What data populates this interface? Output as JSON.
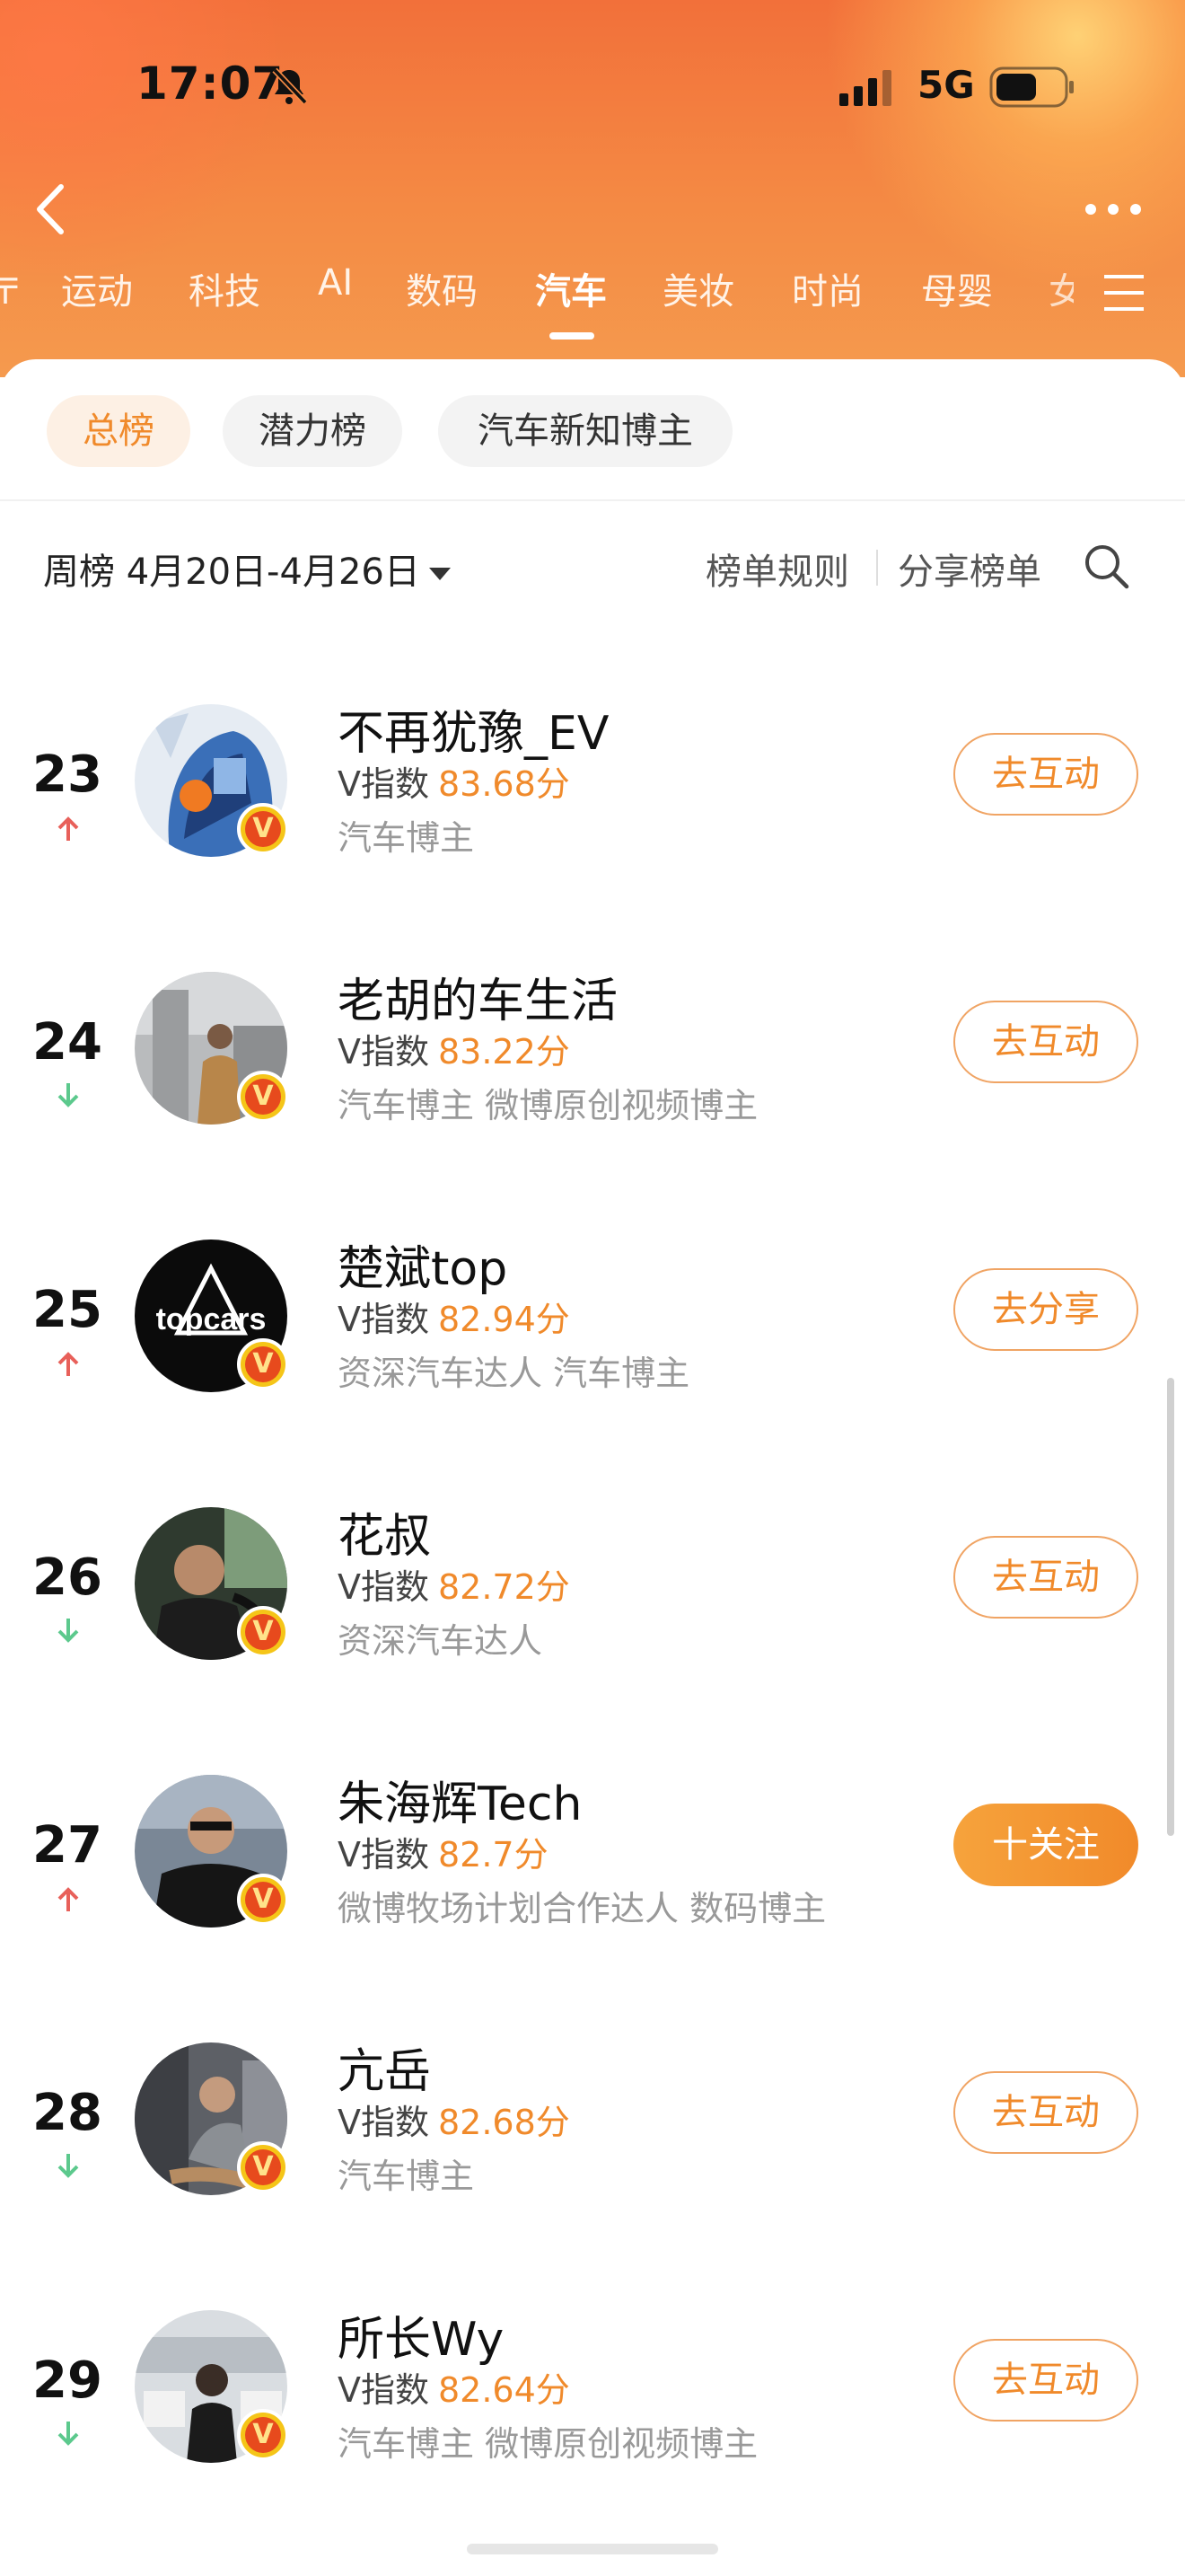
{
  "status_bar": {
    "time": "17:07",
    "network": "5G"
  },
  "header": {
    "categories": [
      "运动",
      "科技",
      "AI",
      "数码",
      "汽车",
      "美妆",
      "时尚",
      "母婴"
    ],
    "active_category": "汽车"
  },
  "segments": [
    "总榜",
    "潜力榜",
    "汽车新知博主"
  ],
  "active_segment": "总榜",
  "toolbar": {
    "week_label": "周榜 4月20日-4月26日",
    "rules_label": "榜单规则",
    "share_label": "分享榜单"
  },
  "colors": {
    "accent": "#f08a2b",
    "rise": "#e8605a",
    "fall": "#5cc98d"
  },
  "icons": {
    "back": "chevron-left-icon",
    "more": "more-dots-icon",
    "menu": "menu-icon",
    "search": "search-icon",
    "verified": "verified-v-icon"
  },
  "ranking": [
    {
      "rank": "23",
      "trend": "up",
      "name": "不再犹豫_EV",
      "vindex_label": "V指数",
      "score": "83.68分",
      "tags": "汽车博主",
      "action": "去互动",
      "action_type": "outline"
    },
    {
      "rank": "24",
      "trend": "down",
      "name": "老胡的车生活",
      "vindex_label": "V指数",
      "score": "83.22分",
      "tags": "汽车博主 微博原创视频博主",
      "action": "去互动",
      "action_type": "outline"
    },
    {
      "rank": "25",
      "trend": "up",
      "name": "楚斌top",
      "vindex_label": "V指数",
      "score": "82.94分",
      "tags": "资深汽车达人 汽车博主",
      "action": "去分享",
      "action_type": "outline"
    },
    {
      "rank": "26",
      "trend": "down",
      "name": "花叔",
      "vindex_label": "V指数",
      "score": "82.72分",
      "tags": "资深汽车达人",
      "action": "去互动",
      "action_type": "outline"
    },
    {
      "rank": "27",
      "trend": "up",
      "name": "朱海辉Tech",
      "vindex_label": "V指数",
      "score": "82.7分",
      "tags": "微博牧场计划合作达人 数码博主",
      "action": "十关注",
      "action_type": "filled"
    },
    {
      "rank": "28",
      "trend": "down",
      "name": "亢岳",
      "vindex_label": "V指数",
      "score": "82.68分",
      "tags": "汽车博主",
      "action": "去互动",
      "action_type": "outline"
    },
    {
      "rank": "29",
      "trend": "down",
      "name": "所长Wy",
      "vindex_label": "V指数",
      "score": "82.64分",
      "tags": "汽车博主 微博原创视频博主",
      "action": "去互动",
      "action_type": "outline"
    }
  ],
  "avatar_logo_text": "topcars"
}
